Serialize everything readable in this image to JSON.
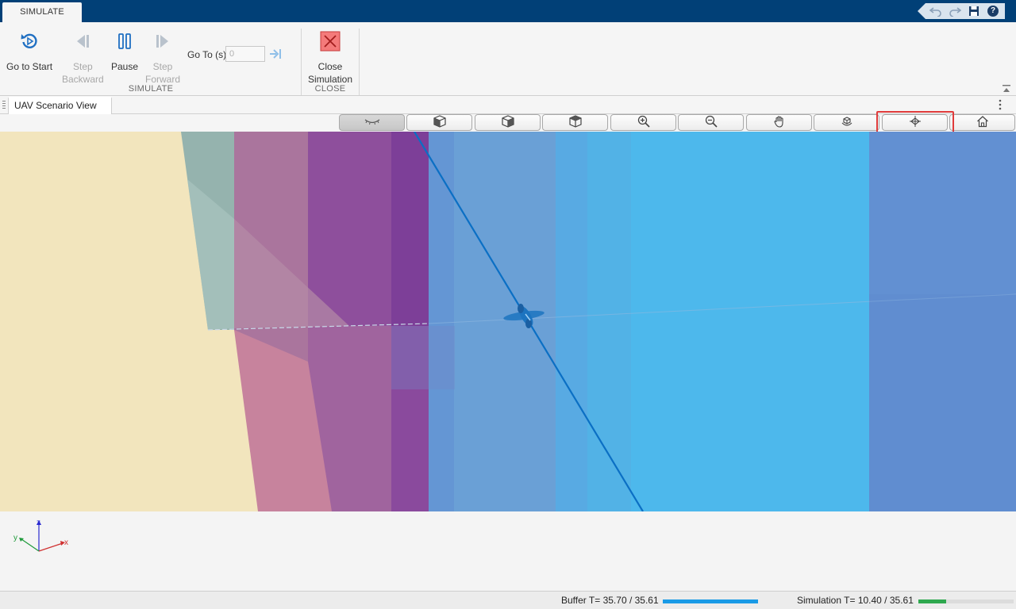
{
  "app": {
    "tab_label": "SIMULATE"
  },
  "ribbon": {
    "go_to_start": "Go to Start",
    "step_backward_1": "Step",
    "step_backward_2": "Backward",
    "pause": "Pause",
    "step_forward_1": "Step",
    "step_forward_2": "Forward",
    "goto_label": "Go To (s)",
    "goto_value": "0",
    "close_sim_1": "Close",
    "close_sim_2": "Simulation",
    "section_simulate": "SIMULATE",
    "section_close": "CLOSE"
  },
  "document": {
    "tab_label": "UAV Scenario View"
  },
  "view_toolbar": {
    "buttons": [
      {
        "icon": "eye-icon",
        "active": true
      },
      {
        "icon": "cube-front-icon",
        "active": false
      },
      {
        "icon": "cube-side-icon",
        "active": false
      },
      {
        "icon": "cube-top-icon",
        "active": false
      },
      {
        "icon": "zoom-in-icon",
        "active": false
      },
      {
        "icon": "zoom-out-icon",
        "active": false
      },
      {
        "icon": "pan-hand-icon",
        "active": false
      },
      {
        "icon": "rotate-3d-icon",
        "active": false
      },
      {
        "icon": "fly-mode-icon",
        "active": false
      },
      {
        "icon": "home-icon",
        "active": false
      }
    ]
  },
  "axes": {
    "x": "x",
    "y": "y",
    "z": "z"
  },
  "status": {
    "buffer_text": "Buffer T= 35.70 / 35.61",
    "buffer_fraction": 1.0,
    "buffer_color": "#1a9be6",
    "simulation_text": "Simulation T= 10.40 / 35.61",
    "simulation_fraction": 0.292,
    "simulation_color": "#2fa84f"
  },
  "colors": {
    "title_bar": "#014077",
    "highlight": "#e03c3c",
    "ground": "#f2e5bd",
    "trajectory": "#0b6fc4"
  }
}
